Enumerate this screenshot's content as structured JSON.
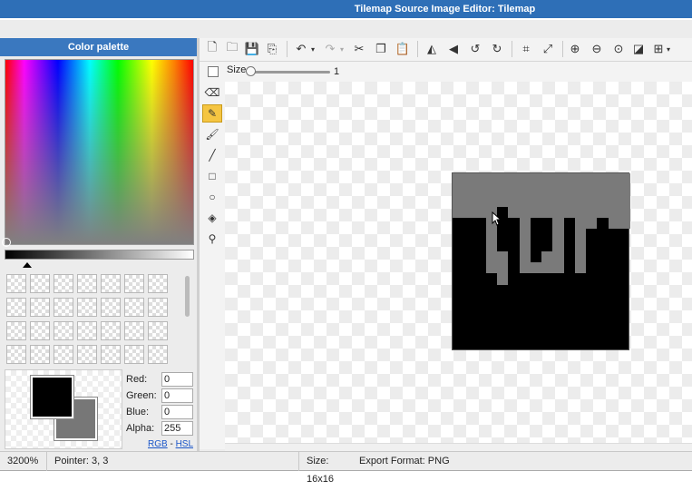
{
  "window": {
    "title": "Tilemap Source Image Editor: Tilemap"
  },
  "palette": {
    "header": "Color palette",
    "foreground_color": "#000000",
    "background_color": "#777777",
    "fields": [
      {
        "label": "Red:",
        "value": "0"
      },
      {
        "label": "Green:",
        "value": "0"
      },
      {
        "label": "Blue:",
        "value": "0"
      },
      {
        "label": "Alpha:",
        "value": "255"
      }
    ],
    "mode_rgb": "RGB",
    "mode_separator": " - ",
    "mode_hsl": "HSL"
  },
  "toolbar": {
    "icons": [
      "new-file-icon",
      "open-folder-icon",
      "save-icon",
      "save-as-icon",
      "undo-icon",
      "redo-icon",
      "cut-icon",
      "copy-icon",
      "paste-icon",
      "flip-horizontal-icon",
      "flip-vertical-icon",
      "rotate-left-icon",
      "rotate-right-icon",
      "crop-icon",
      "resize-icon",
      "zoom-in-icon",
      "zoom-out-icon",
      "zoom-fit-icon",
      "toggle-background-icon",
      "grid-icon"
    ]
  },
  "size_tool": {
    "label": "Size",
    "value": "1",
    "slider_fraction": 0.0
  },
  "tools": [
    "eraser",
    "pencil",
    "brush",
    "line",
    "rectangle",
    "ellipse",
    "fill",
    "eyedropper"
  ],
  "selected_tool": "pencil",
  "status": {
    "zoom": "3200%",
    "pointer": "Pointer: 3, 3",
    "size": "Size: 16x16",
    "export": "Export Format: PNG"
  },
  "image": {
    "width": 16,
    "height": 16,
    "colors": {
      "gray": "#7a7a7a",
      "black": "#000000"
    }
  }
}
